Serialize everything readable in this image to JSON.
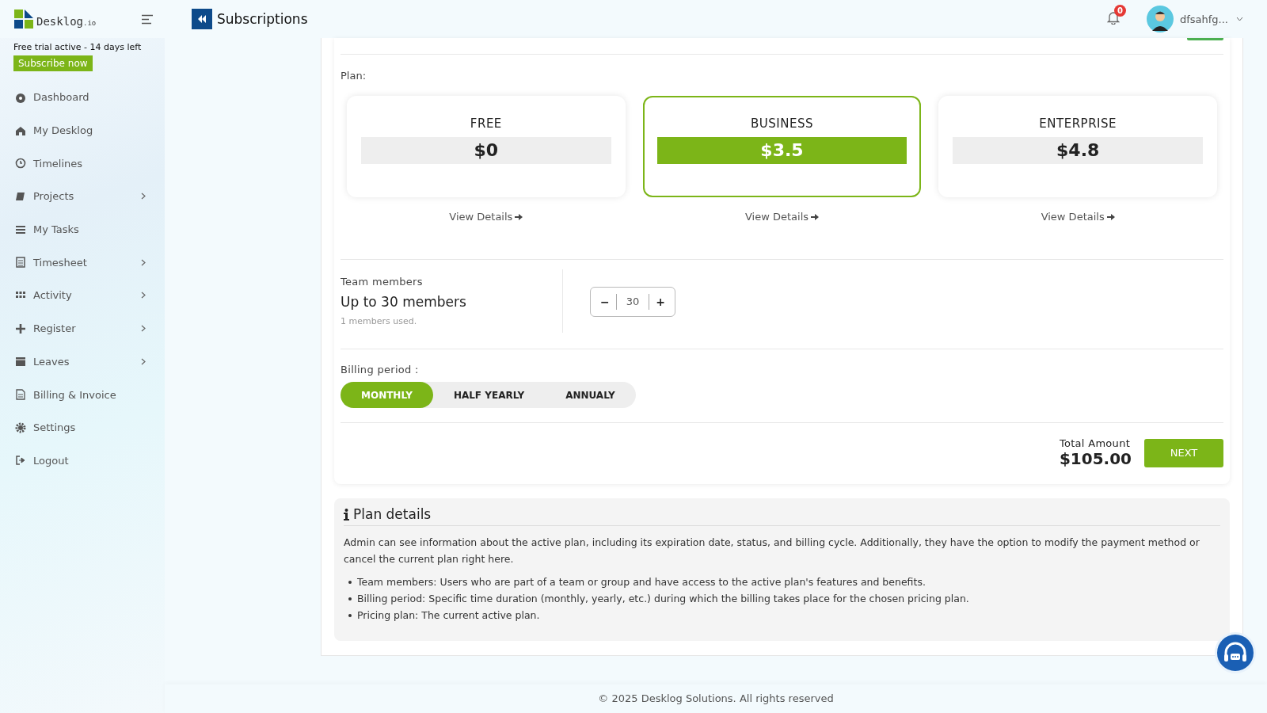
{
  "brand": {
    "name": "Desklog",
    "suffix": ".io"
  },
  "header": {
    "title": "Subscriptions",
    "notifications": "0",
    "user": "dfsahfg..."
  },
  "trial": {
    "text": "Free trial active - 14 days left",
    "button": "Subscribe now"
  },
  "sidebar": {
    "items": [
      {
        "label": "Dashboard",
        "has_children": false
      },
      {
        "label": "My Desklog",
        "has_children": false
      },
      {
        "label": "Timelines",
        "has_children": false
      },
      {
        "label": "Projects",
        "has_children": true
      },
      {
        "label": "My Tasks",
        "has_children": false
      },
      {
        "label": "Timesheet",
        "has_children": true
      },
      {
        "label": "Activity",
        "has_children": true
      },
      {
        "label": "Register",
        "has_children": true
      },
      {
        "label": "Leaves",
        "has_children": true
      },
      {
        "label": "Billing & Invoice",
        "has_children": false
      },
      {
        "label": "Settings",
        "has_children": false
      },
      {
        "label": "Logout",
        "has_children": false
      }
    ]
  },
  "plan_label": "Plan:",
  "plans": [
    {
      "name": "FREE",
      "price": "$0",
      "selected": false,
      "link": "View Details"
    },
    {
      "name": "BUSINESS",
      "price": "$3.5",
      "selected": true,
      "link": "View Details"
    },
    {
      "name": "ENTERPRISE",
      "price": "$4.8",
      "selected": false,
      "link": "View Details"
    }
  ],
  "team": {
    "label": "Team members",
    "limit": "Up to 30 members",
    "used": "1 members used.",
    "minus": "−",
    "value": "30",
    "plus": "+"
  },
  "billing": {
    "label": "Billing period :",
    "options": [
      {
        "label": "MONTHLY",
        "selected": true
      },
      {
        "label": "HALF YEARLY",
        "selected": false
      },
      {
        "label": "ANNUALY",
        "selected": false
      }
    ]
  },
  "total": {
    "label": "Total Amount",
    "amount": "$105.00",
    "button": "NEXT"
  },
  "details": {
    "title": "Plan details",
    "intro": "Admin can see information about the active plan, including its expiration date, status, and billing cycle. Additionally, they have the option to modify the payment method or cancel the current plan right here.",
    "bullets": [
      "Team members: Users who are part of a team or group and have access to the active plan's features and benefits.",
      "Billing period: Specific time duration (monthly, yearly, etc.) during which the billing takes place for the chosen pricing plan.",
      "Pricing plan: The current active plan."
    ]
  },
  "footer": "© 2025 Desklog Solutions. All rights reserved"
}
